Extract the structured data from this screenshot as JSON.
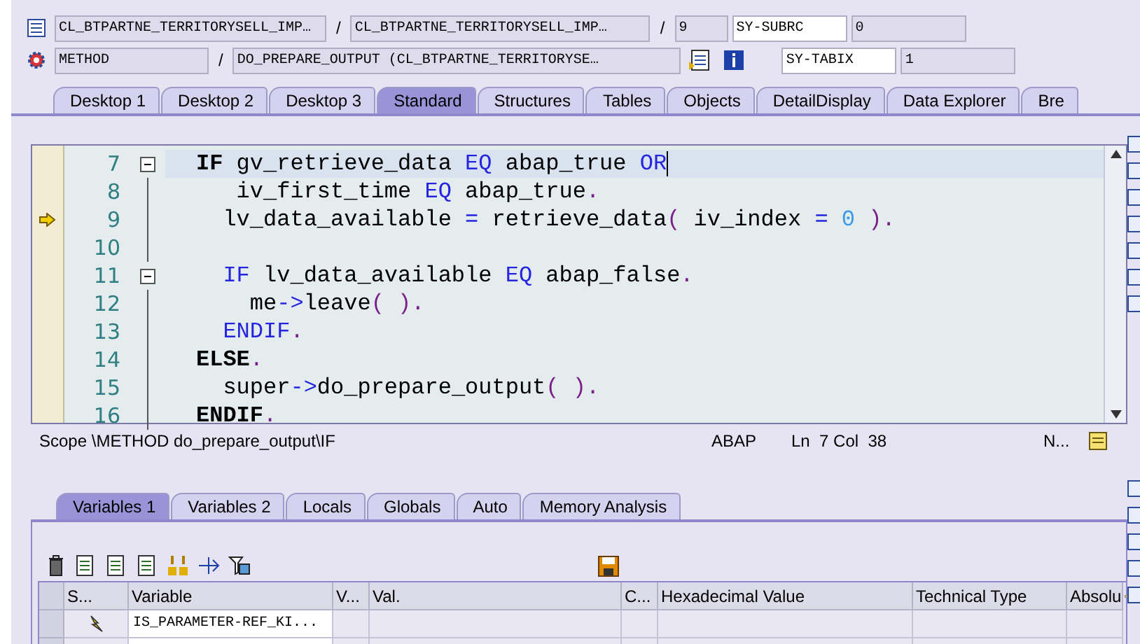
{
  "header": {
    "row1": [
      {
        "kind": "field",
        "value": "CL_BTPARTNE_TERRITORYSELL_IMP…"
      },
      {
        "kind": "sep",
        "text": "/"
      },
      {
        "kind": "field",
        "value": "CL_BTPARTNE_TERRITORYSELL_IMP…"
      },
      {
        "kind": "sep",
        "text": "/"
      },
      {
        "kind": "field",
        "value": "9"
      },
      {
        "kind": "name",
        "value": "SY-SUBRC"
      },
      {
        "kind": "field",
        "value": "0"
      }
    ],
    "row2": [
      {
        "kind": "field",
        "value": "METHOD"
      },
      {
        "kind": "sep",
        "text": "/"
      },
      {
        "kind": "field",
        "value": "DO_PREPARE_OUTPUT (CL_BTPARTNE_TERRITORYSE…"
      },
      {
        "kind": "name",
        "value": "SY-TABIX"
      },
      {
        "kind": "field",
        "value": "1"
      }
    ]
  },
  "desktop_tabs": [
    {
      "label": "Desktop 1",
      "selected": false
    },
    {
      "label": "Desktop 2",
      "selected": false
    },
    {
      "label": "Desktop 3",
      "selected": false
    },
    {
      "label": "Standard",
      "selected": true
    },
    {
      "label": "Structures",
      "selected": false
    },
    {
      "label": "Tables",
      "selected": false
    },
    {
      "label": "Objects",
      "selected": false
    },
    {
      "label": "DetailDisplay",
      "selected": false
    },
    {
      "label": "Data Explorer",
      "selected": false
    },
    {
      "label": "Bre",
      "selected": false
    }
  ],
  "editor": {
    "lines": [
      {
        "number": "7",
        "foldable": true,
        "current": false,
        "cursor": true,
        "tokens": [
          {
            "kind": "keyword",
            "text": "IF"
          },
          {
            "kind": "plain",
            "text": " gv_retrieve_data "
          },
          {
            "kind": "blue",
            "text": "EQ"
          },
          {
            "kind": "plain",
            "text": " abap_true "
          },
          {
            "kind": "blue",
            "text": "OR"
          }
        ]
      },
      {
        "number": "8",
        "foldable": false,
        "current": false,
        "cursor": false,
        "tokens": [
          {
            "kind": "plain",
            "text": "   iv_first_time "
          },
          {
            "kind": "blue",
            "text": "EQ"
          },
          {
            "kind": "plain",
            "text": " abap_true"
          },
          {
            "kind": "punct",
            "text": "."
          }
        ]
      },
      {
        "number": "9",
        "foldable": false,
        "current": true,
        "cursor": false,
        "tokens": [
          {
            "kind": "plain",
            "text": "  lv_data_available "
          },
          {
            "kind": "blue",
            "text": "="
          },
          {
            "kind": "plain",
            "text": " retrieve_data"
          },
          {
            "kind": "punct",
            "text": "("
          },
          {
            "kind": "plain",
            "text": " iv_index "
          },
          {
            "kind": "blue",
            "text": "="
          },
          {
            "kind": "number",
            "text": " 0 "
          },
          {
            "kind": "punct",
            "text": ")."
          }
        ]
      },
      {
        "number": "10",
        "foldable": false,
        "current": false,
        "cursor": false
      },
      {
        "number": "11",
        "foldable": true,
        "current": false,
        "cursor": false,
        "tokens": [
          {
            "kind": "blue",
            "text": "  IF"
          },
          {
            "kind": "plain",
            "text": " lv_data_available "
          },
          {
            "kind": "blue",
            "text": "EQ"
          },
          {
            "kind": "plain",
            "text": " abap_false"
          },
          {
            "kind": "punct",
            "text": "."
          }
        ]
      },
      {
        "number": "12",
        "foldable": false,
        "current": false,
        "cursor": false,
        "tokens": [
          {
            "kind": "plain",
            "text": "    me"
          },
          {
            "kind": "blue",
            "text": "->"
          },
          {
            "kind": "plain",
            "text": "leave"
          },
          {
            "kind": "punct",
            "text": "( )."
          }
        ]
      },
      {
        "number": "13",
        "foldable": false,
        "current": false,
        "cursor": false,
        "tokens": [
          {
            "kind": "blue",
            "text": "  ENDIF"
          },
          {
            "kind": "punct",
            "text": "."
          }
        ]
      },
      {
        "number": "14",
        "foldable": false,
        "current": false,
        "cursor": false,
        "tokens": [
          {
            "kind": "keyword",
            "text": "ELSE"
          },
          {
            "kind": "punct",
            "text": "."
          }
        ]
      },
      {
        "number": "15",
        "foldable": false,
        "current": false,
        "cursor": false,
        "tokens": [
          {
            "kind": "plain",
            "text": "  super"
          },
          {
            "kind": "blue",
            "text": "->"
          },
          {
            "kind": "plain",
            "text": "do_prepare_output"
          },
          {
            "kind": "punct",
            "text": "( )."
          }
        ]
      },
      {
        "number": "16",
        "foldable": false,
        "current": false,
        "cursor": false,
        "tokens": [
          {
            "kind": "keyword",
            "text": "ENDIF"
          },
          {
            "kind": "punct",
            "text": "."
          }
        ]
      }
    ]
  },
  "status_bar": {
    "scope": "Scope \\METHOD do_prepare_output\\IF",
    "language": "ABAP",
    "position": "Ln  7 Col  38",
    "mode": "N..."
  },
  "variable_tabs": [
    {
      "label": "Variables 1",
      "selected": true
    },
    {
      "label": "Variables 2",
      "selected": false
    },
    {
      "label": "Locals",
      "selected": false
    },
    {
      "label": "Globals",
      "selected": false
    },
    {
      "label": "Auto",
      "selected": false
    },
    {
      "label": "Memory Analysis",
      "selected": false
    }
  ],
  "table": {
    "columns": [
      "S...",
      "Variable",
      "V...",
      "Val.",
      "C...",
      "Hexadecimal Value",
      "Technical Type",
      "Absolu"
    ],
    "rows": [
      {
        "icon": true,
        "variable": "IS_PARAMETER-REF_KI..."
      }
    ]
  }
}
